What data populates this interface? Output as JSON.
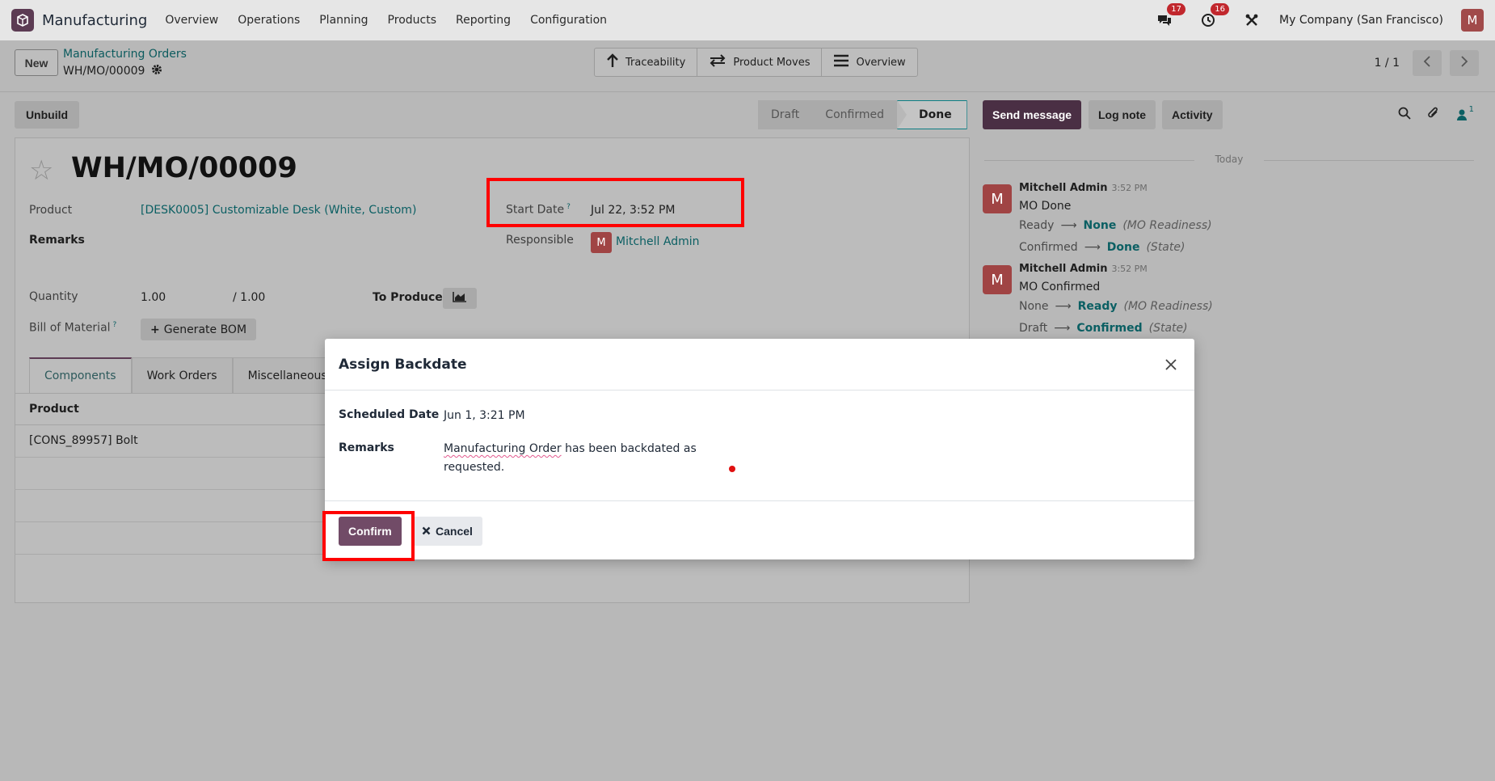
{
  "navbar": {
    "app_name": "Manufacturing",
    "menu": [
      "Overview",
      "Operations",
      "Planning",
      "Products",
      "Reporting",
      "Configuration"
    ],
    "messages_badge": "17",
    "activities_badge": "16",
    "company": "My Company (San Francisco)",
    "user_initial": "M"
  },
  "control_panel": {
    "new_label": "New",
    "breadcrumb_parent": "Manufacturing Orders",
    "breadcrumb_current": "WH/MO/00009",
    "smart_buttons": [
      "Traceability",
      "Product Moves",
      "Overview"
    ],
    "pager": "1 / 1"
  },
  "form": {
    "unbuild_label": "Unbuild",
    "status_steps": [
      "Draft",
      "Confirmed",
      "Done"
    ],
    "title": "WH/MO/00009",
    "product_label": "Product",
    "product_value": "[DESK0005] Customizable Desk (White, Custom)",
    "remarks_label": "Remarks",
    "start_date_label": "Start Date",
    "start_date_value": "Jul 22, 3:52 PM",
    "responsible_label": "Responsible",
    "responsible_value": "Mitchell Admin",
    "responsible_initial": "M",
    "quantity_label": "Quantity",
    "quantity_value": "1.00",
    "quantity_total": "/ 1.00",
    "to_produce_label": "To Produce",
    "bom_label": "Bill of Material",
    "generate_bom_label": "Generate BOM",
    "tooltip_mark": "?",
    "tabs": [
      "Components",
      "Work Orders",
      "Miscellaneous"
    ],
    "list_header": "Product",
    "list_rows": [
      "[CONS_89957] Bolt"
    ]
  },
  "chatter": {
    "send_message": "Send message",
    "log_note": "Log note",
    "activity": "Activity",
    "followers_count": "1",
    "today_label": "Today",
    "messages": [
      {
        "author": "Mitchell Admin",
        "initial": "M",
        "time": "3:52 PM",
        "body": "MO Done",
        "tracking": [
          {
            "old": "Ready",
            "new": "None",
            "field": "(MO Readiness)"
          },
          {
            "old": "Confirmed",
            "new": "Done",
            "field": "(State)"
          }
        ]
      },
      {
        "author": "Mitchell Admin",
        "initial": "M",
        "time": "3:52 PM",
        "body": "MO Confirmed",
        "tracking": [
          {
            "old": "None",
            "new": "Ready",
            "field": "(MO Readiness)"
          },
          {
            "old": "Draft",
            "new": "Confirmed",
            "field": "(State)"
          }
        ]
      }
    ]
  },
  "modal": {
    "title": "Assign Backdate",
    "scheduled_date_label": "Scheduled Date",
    "scheduled_date_value": "Jun 1, 3:21 PM",
    "remarks_label": "Remarks",
    "remarks_link": "Manufacturing Order",
    "remarks_rest": " has been backdated as requested.",
    "confirm_label": "Confirm",
    "cancel_label": "Cancel"
  },
  "colors": {
    "brand": "#714b67",
    "link": "#017e84",
    "highlight": "#ff0000"
  }
}
